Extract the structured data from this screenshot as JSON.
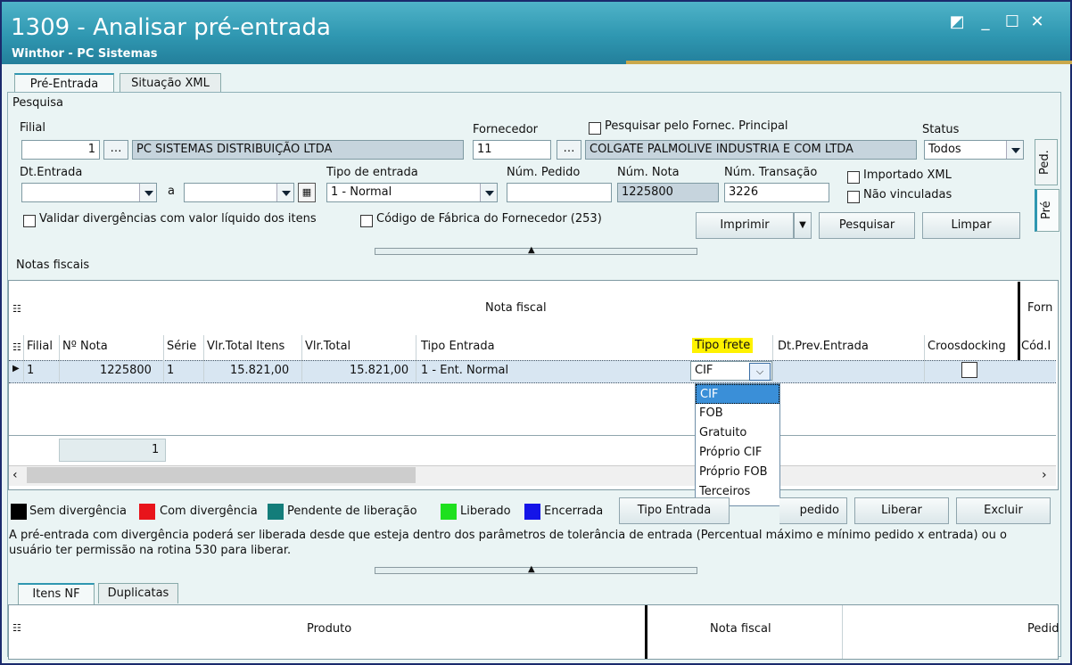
{
  "window": {
    "title": "1309 - Analisar pré-entrada",
    "subtitle": "Winthor - PC Sistemas",
    "controls": [
      "◩",
      "_",
      "☐",
      "✕"
    ]
  },
  "tabs": {
    "pre_entrada": "Pré-Entrada",
    "situacao_xml": "Situação XML"
  },
  "pesquisa": {
    "section": "Pesquisa",
    "filial_label": "Filial",
    "filial_value": "1",
    "filial_name": "PC SISTEMAS DISTRIBUIÇÃO LTDA",
    "fornecedor_label": "Fornecedor",
    "fornecedor_value": "11",
    "fornecedor_name": "COLGATE PALMOLIVE INDUSTRIA  E COM LTDA",
    "pesquisar_principal": "Pesquisar pelo Fornec. Principal",
    "status_label": "Status",
    "status_value": "Todos",
    "dt_entrada_label": "Dt.Entrada",
    "a_label": "a",
    "tipo_entrada_label": "Tipo de entrada",
    "tipo_entrada_value": "1 - Normal",
    "num_pedido_label": "Núm. Pedido",
    "num_nota_label": "Núm. Nota",
    "num_nota_value": "1225800",
    "num_transacao_label": "Núm. Transação",
    "num_transacao_value": "3226",
    "importado_xml": "Importado XML",
    "nao_vinculadas": "Não vinculadas",
    "validar_divergencias": "Validar divergências com valor líquido dos itens",
    "codigo_fabrica": "Código de Fábrica do Fornecedor (253)",
    "btn_imprimir": "Imprimir",
    "btn_pesquisar": "Pesquisar",
    "btn_limpar": "Limpar",
    "side_tab_ped": "Ped.",
    "side_tab_pre": "Pré"
  },
  "notas": {
    "section": "Notas fiscais",
    "group_header": "Nota fiscal",
    "group_header_right": "Forn",
    "columns": [
      "Filial",
      "Nº Nota",
      "Série",
      "Vlr.Total Itens",
      "Vlr.Total",
      "Tipo Entrada",
      "Tipo frete",
      "Dt.Prev.Entrada",
      "Croosdocking",
      "Cód.I"
    ],
    "row": {
      "filial": "1",
      "nota": "1225800",
      "serie": "1",
      "vlr_itens": "15.821,00",
      "vlr_total": "15.821,00",
      "tipo_entrada": "1 - Ent. Normal",
      "tipo_frete": "CIF"
    },
    "footer_count": "1",
    "frete_options": [
      "CIF",
      "FOB",
      "Gratuito",
      "Próprio CIF",
      "Próprio FOB",
      "Terceiros"
    ]
  },
  "legend": [
    {
      "label": "Sem divergência",
      "color": "#000000"
    },
    {
      "label": "Com divergência",
      "color": "#e8141b"
    },
    {
      "label": "Pendente de liberação",
      "color": "#137d7a"
    },
    {
      "label": "Liberado",
      "color": "#1ee01e"
    },
    {
      "label": "Encerrada",
      "color": "#1414e8"
    }
  ],
  "actions": {
    "tipo_entrada": "Tipo Entrada",
    "vincular_pedido": "Vincular pedido",
    "liberar": "Liberar",
    "excluir": "Excluir"
  },
  "info_text": "A pré-entrada com divergência poderá ser liberada desde que esteja dentro dos parâmetros de tolerância de entrada (Percentual máximo e mínimo pedido x entrada) ou o usuário ter permissão na rotina 530 para liberar.",
  "bottom_tabs": {
    "itens_nf": "Itens NF",
    "duplicatas": "Duplicatas"
  },
  "bottom_grid": {
    "produto": "Produto",
    "nota_fiscal": "Nota fiscal",
    "pedido": "Pedid"
  }
}
